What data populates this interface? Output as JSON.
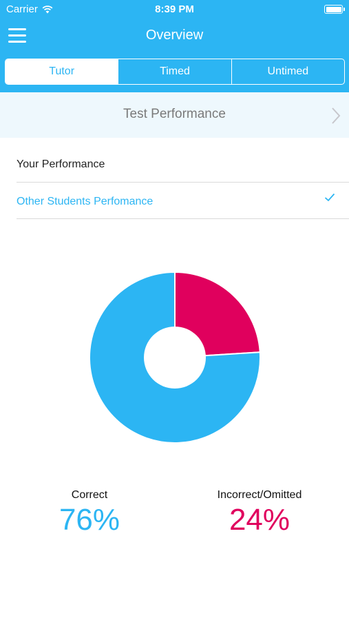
{
  "status_bar": {
    "carrier": "Carrier",
    "time": "8:39 PM"
  },
  "nav": {
    "title": "Overview",
    "menu_icon": "hamburger-menu-icon"
  },
  "tabs": [
    {
      "label": "Tutor",
      "active": true
    },
    {
      "label": "Timed",
      "active": false
    },
    {
      "label": "Untimed",
      "active": false
    }
  ],
  "test_performance": {
    "label": "Test Performance",
    "icon": "chevron-right-icon"
  },
  "options": [
    {
      "label": "Your Performance",
      "selected": false
    },
    {
      "label": "Other Students Perfomance",
      "selected": true
    }
  ],
  "colors": {
    "accent": "#2cb5f3",
    "incorrect": "#e0005d"
  },
  "chart_data": {
    "type": "pie",
    "style": "donut",
    "slices": [
      {
        "label": "Correct",
        "value": 76,
        "color": "#2cb5f3"
      },
      {
        "label": "Incorrect/Omitted",
        "value": 24,
        "color": "#e0005d"
      }
    ]
  },
  "stats": {
    "correct": {
      "label": "Correct",
      "value": "76%"
    },
    "incorrect": {
      "label": "Incorrect/Omitted",
      "value": "24%"
    }
  }
}
